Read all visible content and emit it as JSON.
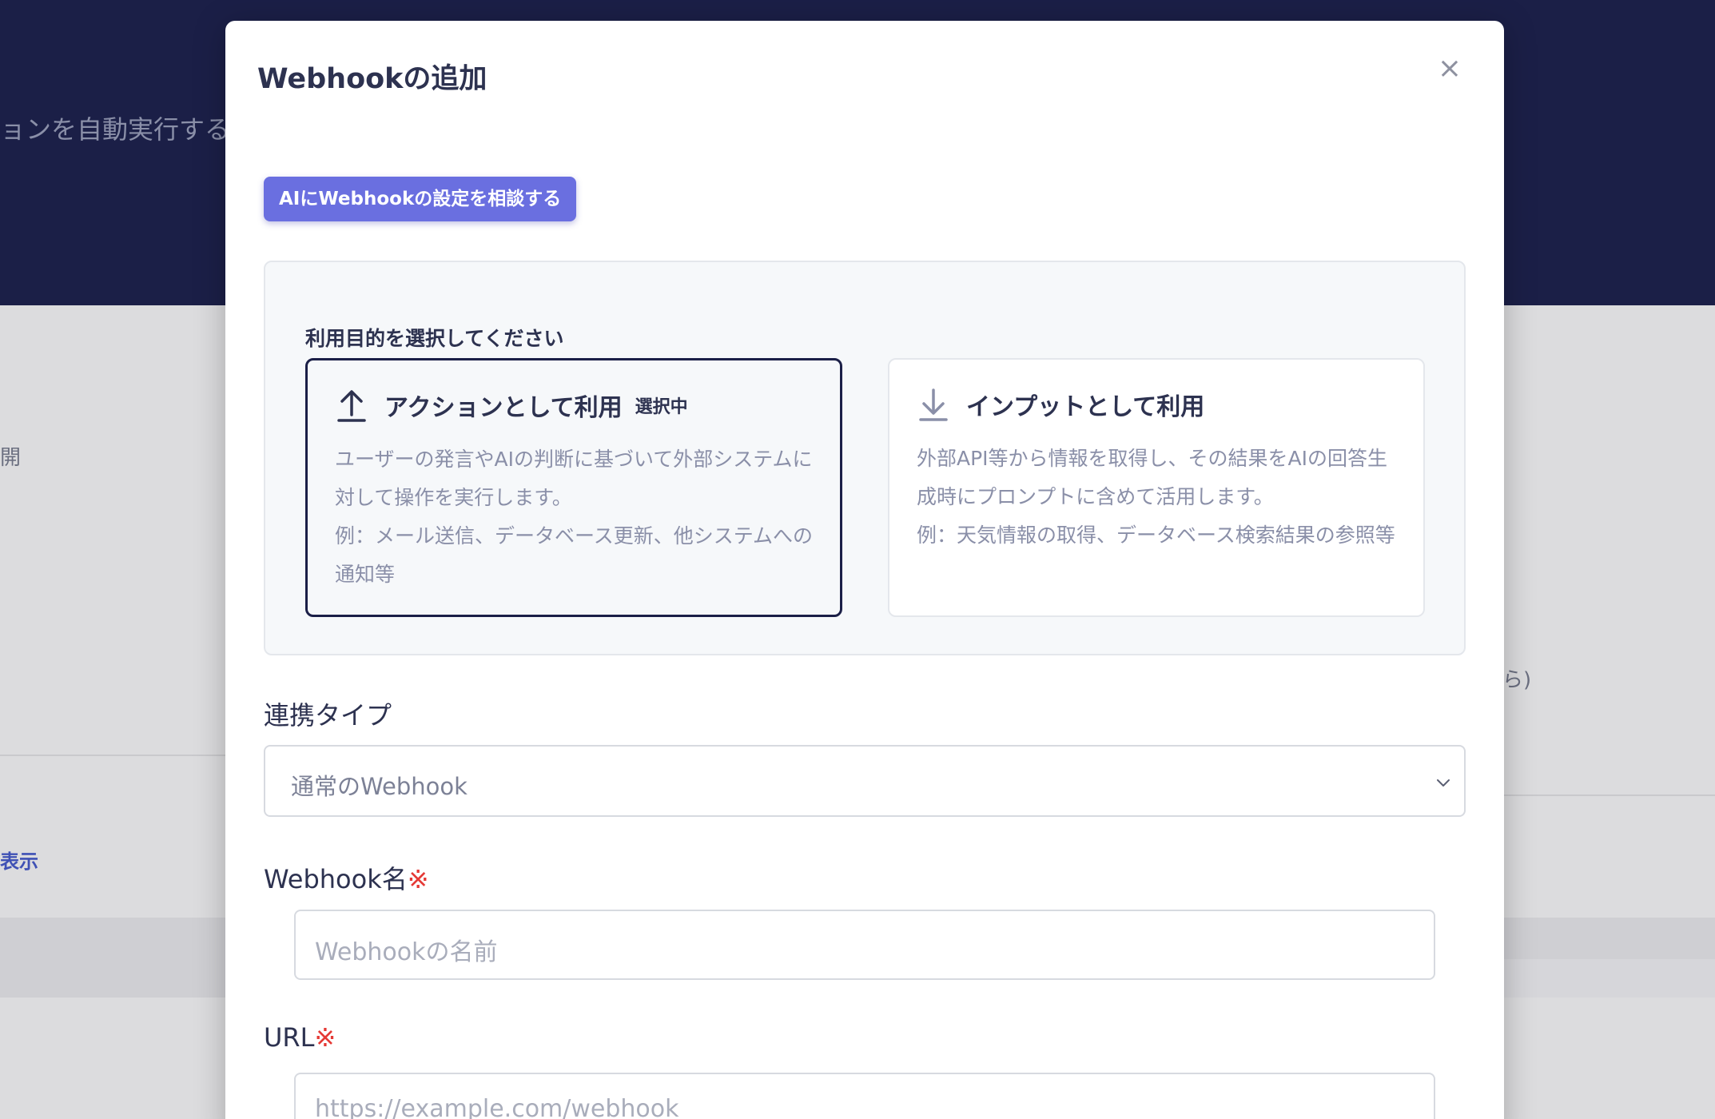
{
  "background": {
    "header_text": "ョンを自動実行する",
    "left_text_1": "開",
    "left_link": "表示",
    "right_text": "ら)"
  },
  "modal": {
    "title": "Webhookの追加",
    "close_label": "×",
    "ai_button_label": "AIにWebhookの設定を相談する",
    "purpose": {
      "label": "利用目的を選択してください",
      "options": [
        {
          "title": "アクションとして利用",
          "badge": "選択中",
          "icon": "upload-arrow-icon",
          "selected": true,
          "description": "ユーザーの発言やAIの判断に基づいて外部システムに対して操作を実行します。",
          "example": "例：メール送信、データベース更新、他システムへの通知等"
        },
        {
          "title": "インプットとして利用",
          "icon": "download-arrow-icon",
          "selected": false,
          "description": "外部API等から情報を取得し、その結果をAIの回答生成時にプロンプトに含めて活用します。",
          "example": "例：天気情報の取得、データベース検索結果の参照等"
        }
      ]
    },
    "integration_type": {
      "label": "連携タイプ",
      "value": "通常のWebhook"
    },
    "webhook_name": {
      "label": "Webhook名",
      "required_mark": "※",
      "placeholder": "Webhookの名前"
    },
    "url": {
      "label": "URL",
      "required_mark": "※",
      "placeholder": "https://example.com/webhook"
    }
  },
  "colors": {
    "header_bg": "#1b1f47",
    "accent_button": "#6a6fe0",
    "required": "#e53935",
    "text_primary": "#2d3250",
    "text_muted": "#8a8fa8"
  }
}
